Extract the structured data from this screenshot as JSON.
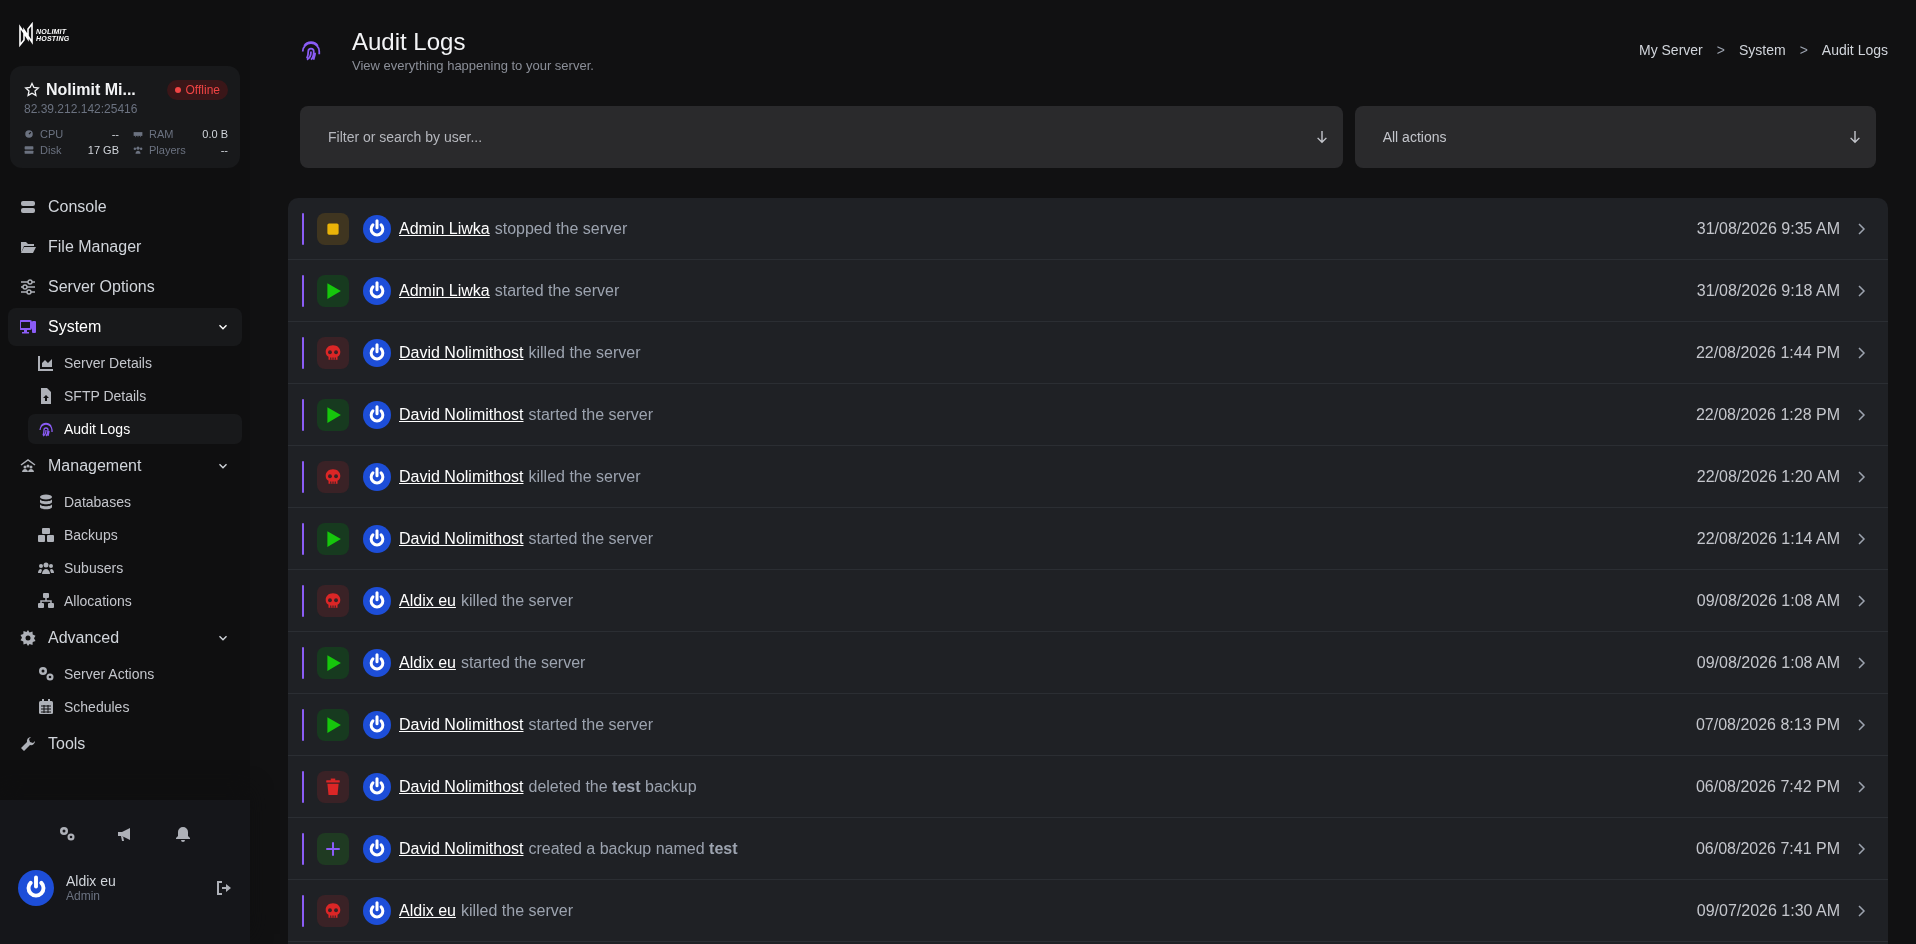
{
  "sidebar": {
    "logo": {
      "line_1": "NOLIMIT",
      "line_2": "HOSTING"
    },
    "server": {
      "name": "Nolimit Mi...",
      "status": "Offline",
      "online": false,
      "address": "82.39.212.142:25416",
      "stats": [
        {
          "kind": "cpu",
          "label": "CPU",
          "value": "--"
        },
        {
          "kind": "ram",
          "label": "RAM",
          "value": "0.0 B"
        },
        {
          "kind": "disk",
          "label": "Disk",
          "value": "17 GB"
        },
        {
          "kind": "players",
          "label": "Players",
          "value": "--"
        }
      ]
    },
    "nav": [
      {
        "label": "Console",
        "kind": "console",
        "selected": false
      },
      {
        "label": "File Manager",
        "kind": "folder",
        "selected": false
      },
      {
        "label": "Server Options",
        "kind": "sliders",
        "selected": false
      },
      {
        "label": "System",
        "kind": "monitor",
        "selected": true,
        "expanded": true,
        "children": [
          {
            "label": "Server Details",
            "kind": "chart",
            "selected": false
          },
          {
            "label": "SFTP Details",
            "kind": "file",
            "selected": false
          },
          {
            "label": "Audit Logs",
            "kind": "fingerprint",
            "selected": true
          }
        ]
      },
      {
        "label": "Management",
        "kind": "people-roof",
        "selected": false,
        "expanded": true,
        "children": [
          {
            "label": "Databases",
            "kind": "database",
            "selected": false
          },
          {
            "label": "Backups",
            "kind": "boxes",
            "selected": false
          },
          {
            "label": "Subusers",
            "kind": "users",
            "selected": false
          },
          {
            "label": "Allocations",
            "kind": "network",
            "selected": false
          }
        ]
      },
      {
        "label": "Advanced",
        "kind": "gear",
        "selected": false,
        "expanded": true,
        "children": [
          {
            "label": "Server Actions",
            "kind": "gears",
            "selected": false
          },
          {
            "label": "Schedules",
            "kind": "calendar",
            "selected": false
          }
        ]
      },
      {
        "label": "Tools",
        "kind": "wrench",
        "selected": false
      }
    ],
    "user": {
      "name": "Aldix eu",
      "role": "Admin"
    }
  },
  "header": {
    "title": "Audit Logs",
    "subtitle": "View everything happening to your server.",
    "breadcrumbs": [
      "My Server",
      "System",
      "Audit Logs"
    ],
    "separator": ">"
  },
  "filters": [
    {
      "placeholder": "Filter or search by user...",
      "kind": "search"
    },
    {
      "value": "All actions",
      "kind": "select"
    }
  ],
  "logs": [
    {
      "kind": "stop",
      "user": "Admin Liwka",
      "action": "stopped the server",
      "time": "31/08/2026 9:35 AM"
    },
    {
      "kind": "start",
      "user": "Admin Liwka",
      "action": "started the server",
      "time": "31/08/2026 9:18 AM"
    },
    {
      "kind": "kill",
      "user": "David Nolimithost",
      "action": "killed the server",
      "time": "22/08/2026 1:44 PM"
    },
    {
      "kind": "start",
      "user": "David Nolimithost",
      "action": "started the server",
      "time": "22/08/2026 1:28 PM"
    },
    {
      "kind": "kill",
      "user": "David Nolimithost",
      "action": "killed the server",
      "time": "22/08/2026 1:20 AM"
    },
    {
      "kind": "start",
      "user": "David Nolimithost",
      "action": "started the server",
      "time": "22/08/2026 1:14 AM"
    },
    {
      "kind": "kill",
      "user": "Aldix eu",
      "action": "killed the server",
      "time": "09/08/2026 1:08 AM"
    },
    {
      "kind": "start",
      "user": "Aldix eu",
      "action": "started the server",
      "time": "09/08/2026 1:08 AM"
    },
    {
      "kind": "start",
      "user": "David Nolimithost",
      "action": "started the server",
      "time": "07/08/2026 8:13 PM"
    },
    {
      "kind": "delete",
      "user": "David Nolimithost",
      "action": "deleted the **test** backup",
      "time": "06/08/2026 7:42 PM"
    },
    {
      "kind": "create",
      "user": "David Nolimithost",
      "action": "created a backup named **test**",
      "time": "06/08/2026 7:41 PM"
    },
    {
      "kind": "kill",
      "user": "Aldix eu",
      "action": "killed the server",
      "time": "09/07/2026 1:30 AM"
    }
  ]
}
